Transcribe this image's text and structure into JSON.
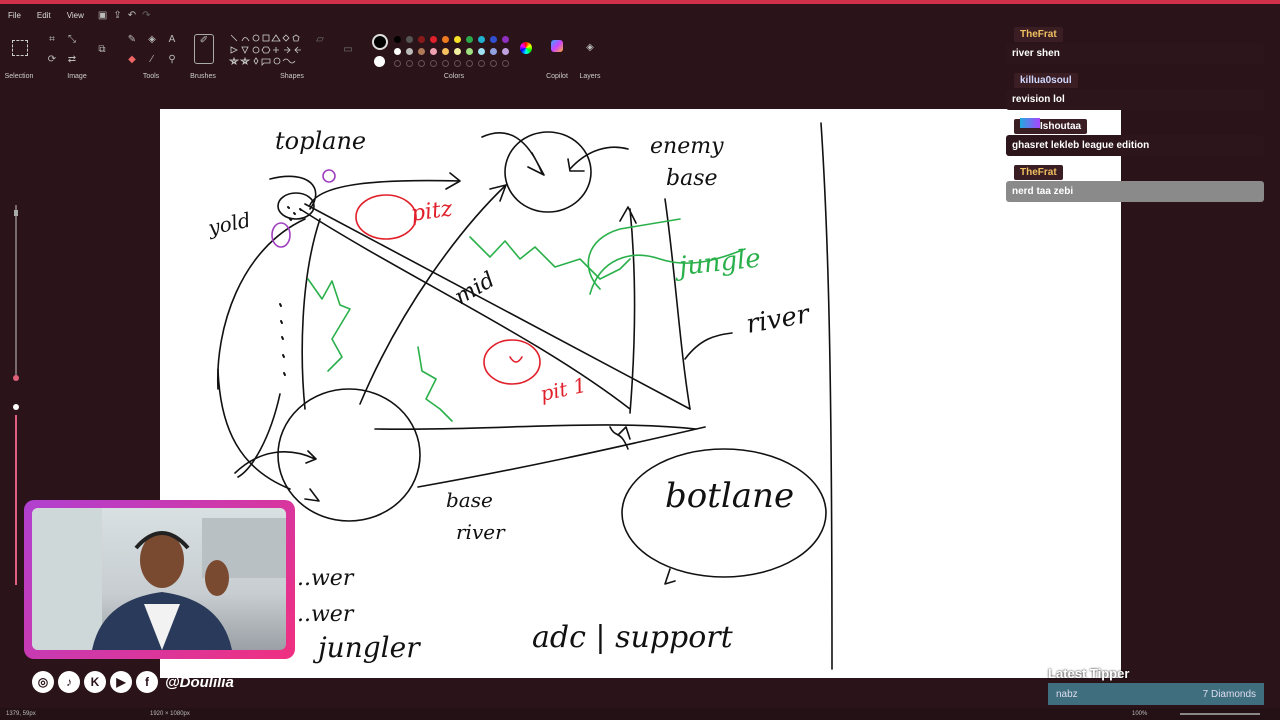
{
  "menu": {
    "items": [
      "File",
      "Edit",
      "View"
    ]
  },
  "ribbon": {
    "groups": [
      "Selection",
      "Image",
      "Tools",
      "Brushes",
      "Shapes",
      "Colors",
      "Copilot",
      "Layers"
    ]
  },
  "colors": {
    "row1": [
      "#000000",
      "#555555",
      "#8a1a1a",
      "#e0202a",
      "#f07a20",
      "#f5e02a",
      "#2aa84a",
      "#20b0d0",
      "#3050d0",
      "#9030c0"
    ],
    "row2": [
      "#ffffff",
      "#bbbbbb",
      "#b07a5a",
      "#f0a0b0",
      "#f5c060",
      "#f0f0a0",
      "#a0e080",
      "#a0e0f0",
      "#90a0e0",
      "#c0a0e0"
    ]
  },
  "drawing": {
    "labels": {
      "toplane": "toplane",
      "enemy_base": "enemy",
      "enemy_base2": "base",
      "yold": "yold",
      "pitz": "pitz",
      "mid": "mid",
      "jungle": "jungle",
      "river": "river",
      "pit1": "pit 1",
      "botlane": "botlane",
      "base_river": "base",
      "base_river2": "river",
      "adc_support": "adc | support",
      "tower1": "...wer",
      "tower2": "...wer",
      "jungler": "jungler"
    }
  },
  "chat": [
    {
      "user": "TheFrat",
      "user_color": "#f0c060",
      "message": "river shen",
      "faded": false,
      "badge": false
    },
    {
      "user": "killua0soul",
      "user_color": "#d0d8ff",
      "message": "revision lol",
      "faded": false,
      "badge": false
    },
    {
      "user": "Ishoutaa",
      "user_color": "#ffffff",
      "message": "ghasret lekleb league edition",
      "faded": false,
      "badge": true
    },
    {
      "user": "TheFrat",
      "user_color": "#f0c060",
      "message": "nerd taa zebi",
      "faded": true,
      "badge": false
    }
  ],
  "social": {
    "handle": "@Doulilia",
    "icons": [
      "instagram-icon",
      "tiktok-icon",
      "kick-icon",
      "youtube-icon",
      "facebook-icon"
    ]
  },
  "tipper": {
    "title": "Latest Tipper",
    "name": "nabz",
    "amount": "7 Diamonds"
  },
  "status": {
    "cursor": "1379, 59px",
    "size": "1920 × 1080px",
    "zoom": "100%"
  }
}
